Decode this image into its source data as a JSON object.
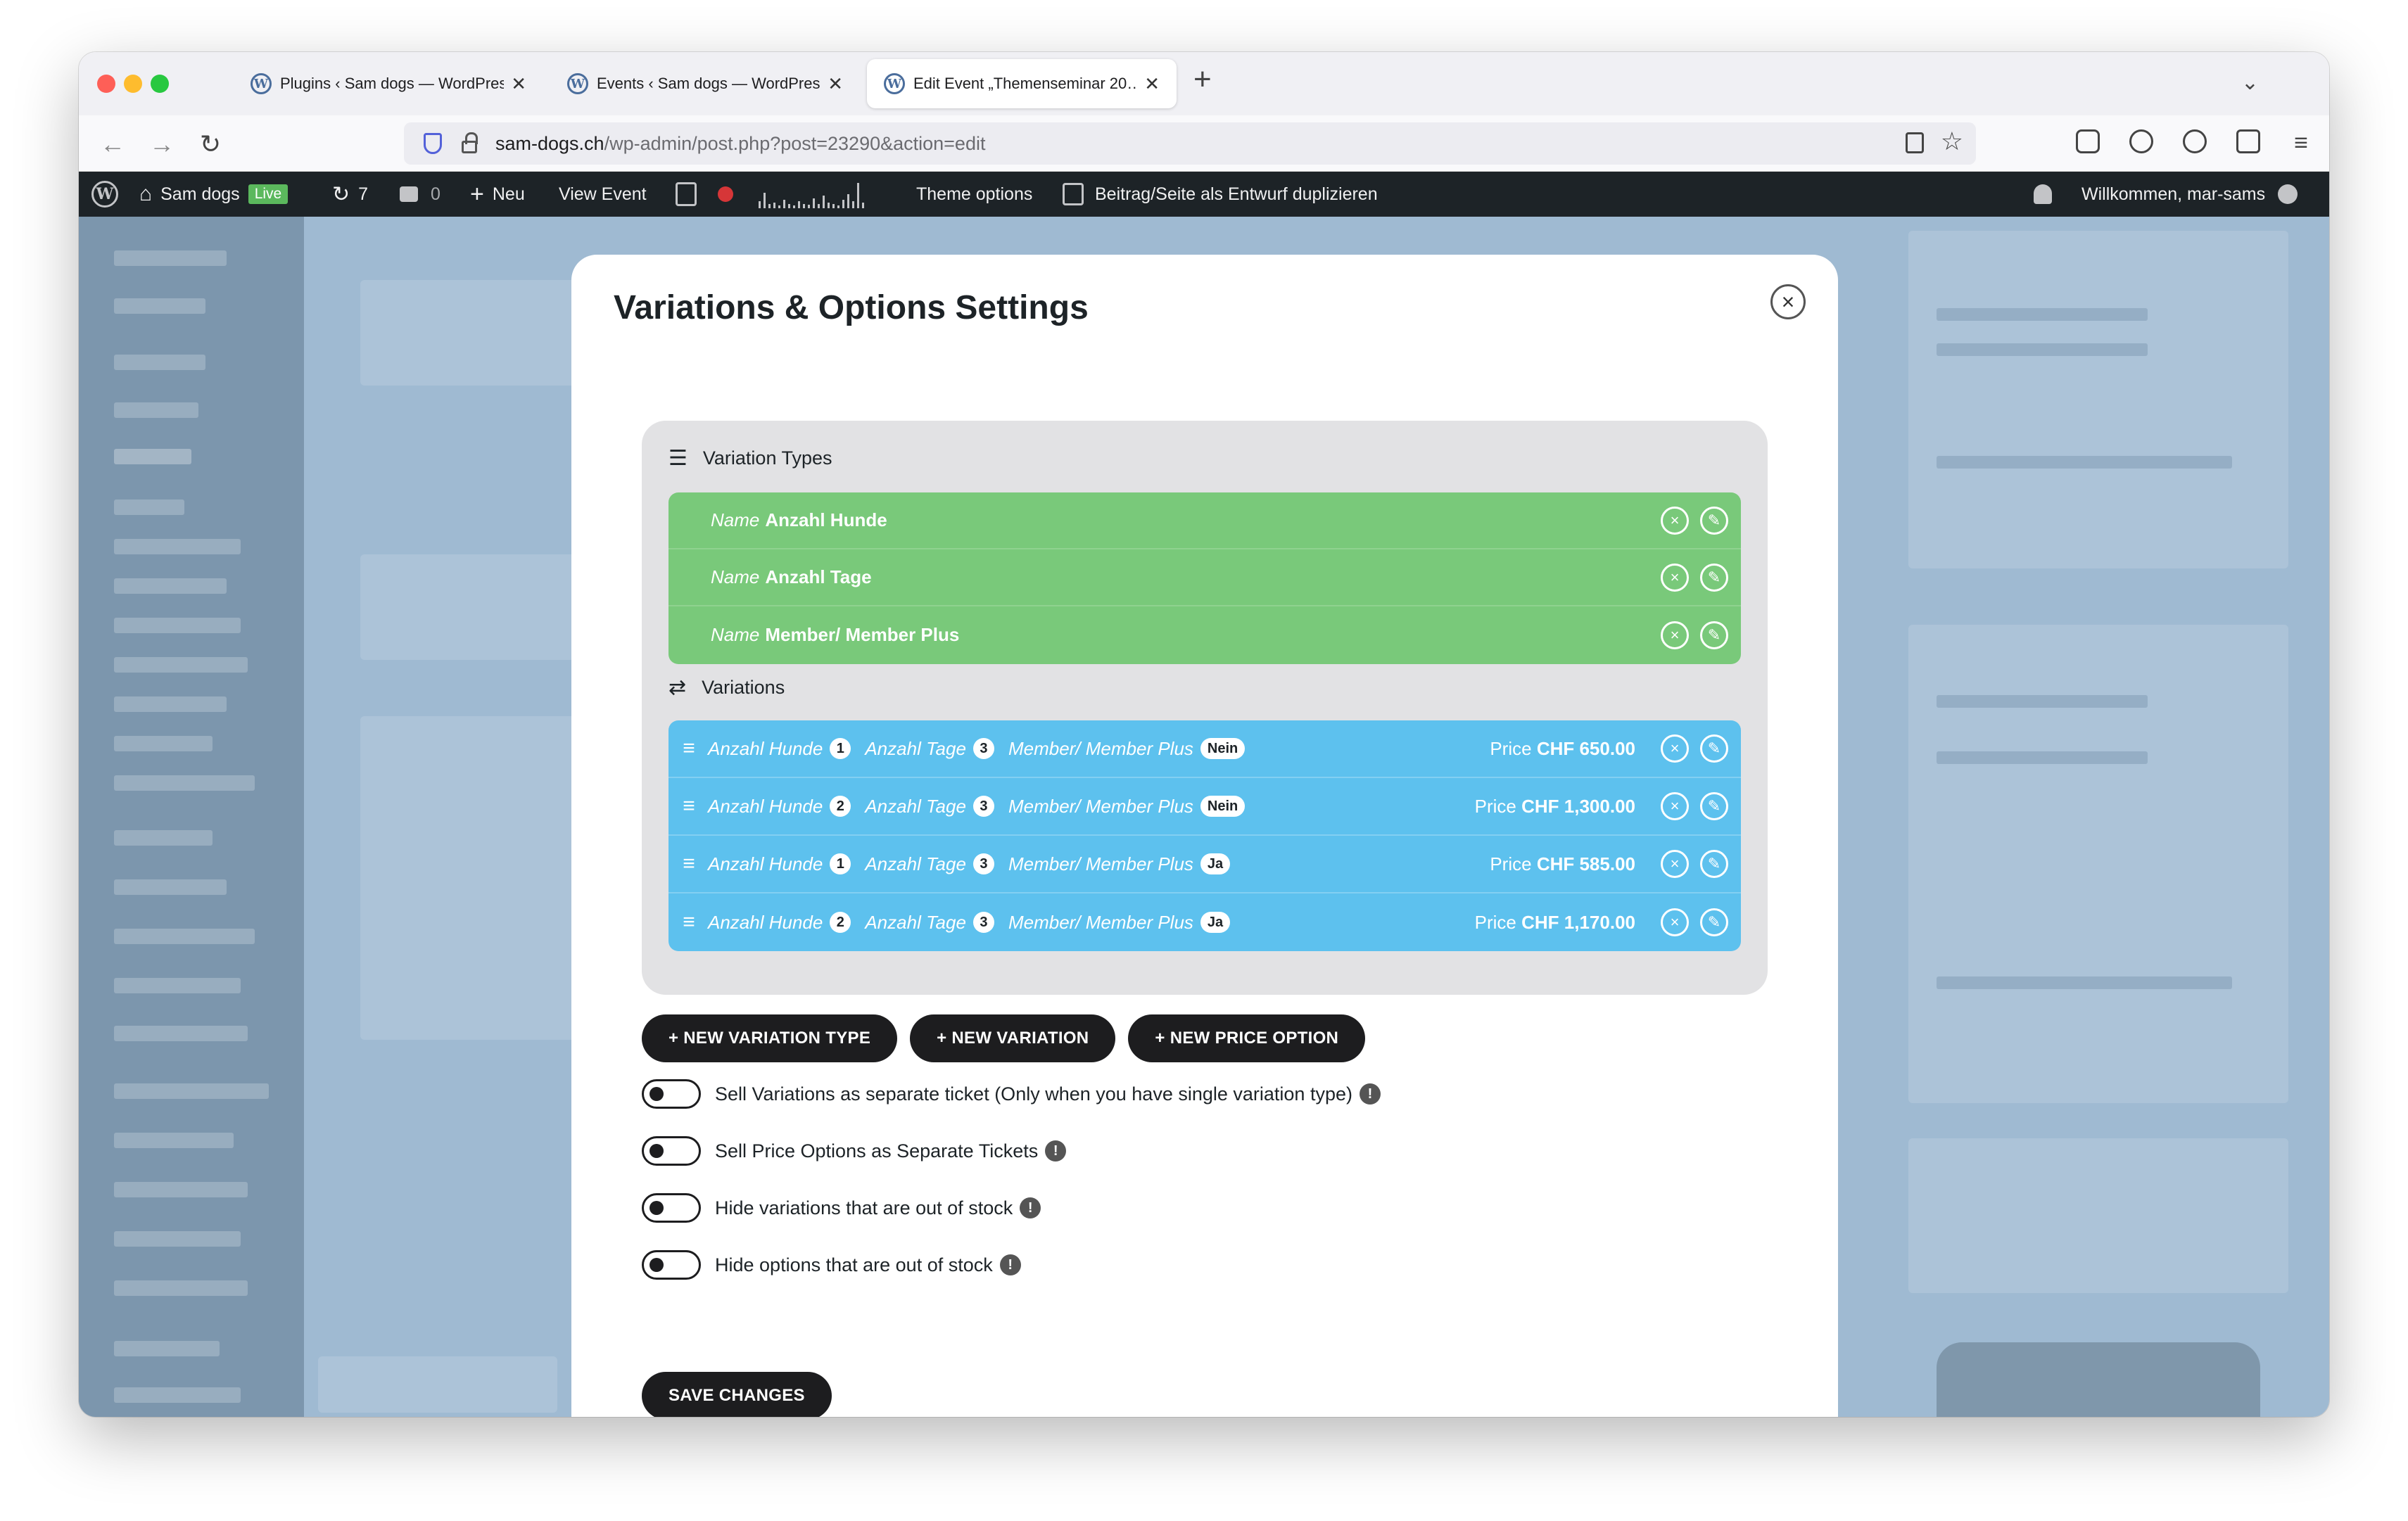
{
  "browser": {
    "tabs": [
      {
        "label": "Plugins ‹ Sam dogs — WordPress",
        "active": false
      },
      {
        "label": "Events ‹ Sam dogs — WordPress",
        "active": false
      },
      {
        "label": "Edit Event „Themenseminar 20…",
        "active": true
      }
    ],
    "new_tab": "+",
    "url_host": "sam-dogs.ch",
    "url_path": "/wp-admin/post.php?post=23290&action=edit"
  },
  "admin_bar": {
    "site_name": "Sam dogs",
    "live_badge": "Live",
    "updates_count": "7",
    "comments_count": "0",
    "new_label": "Neu",
    "view_event": "View Event",
    "theme_options": "Theme options",
    "duplicate": "Beitrag/Seite als Entwurf duplizieren",
    "greeting": "Willkommen, mar-sams"
  },
  "modal": {
    "title": "Variations & Options Settings",
    "variation_types_heading": "Variation Types",
    "variation_types": [
      {
        "field": "Name",
        "value": "Anzahl Hunde"
      },
      {
        "field": "Name",
        "value": "Anzahl Tage"
      },
      {
        "field": "Name",
        "value": "Member/ Member Plus"
      }
    ],
    "variations_heading": "Variations",
    "variations": [
      {
        "hunde_label": "Anzahl Hunde",
        "hunde": "1",
        "tage_label": "Anzahl Tage",
        "tage": "3",
        "member_label": "Member/ Member Plus",
        "member": "Nein",
        "price_label": "Price",
        "price": "CHF 650.00"
      },
      {
        "hunde_label": "Anzahl Hunde",
        "hunde": "2",
        "tage_label": "Anzahl Tage",
        "tage": "3",
        "member_label": "Member/ Member Plus",
        "member": "Nein",
        "price_label": "Price",
        "price": "CHF 1,300.00"
      },
      {
        "hunde_label": "Anzahl Hunde",
        "hunde": "1",
        "tage_label": "Anzahl Tage",
        "tage": "3",
        "member_label": "Member/ Member Plus",
        "member": "Ja",
        "price_label": "Price",
        "price": "CHF 585.00"
      },
      {
        "hunde_label": "Anzahl Hunde",
        "hunde": "2",
        "tage_label": "Anzahl Tage",
        "tage": "3",
        "member_label": "Member/ Member Plus",
        "member": "Ja",
        "price_label": "Price",
        "price": "CHF 1,170.00"
      }
    ],
    "buttons": {
      "new_variation_type": "+ NEW VARIATION TYPE",
      "new_variation": "+ NEW VARIATION",
      "new_price_option": "+ NEW PRICE OPTION",
      "save": "SAVE CHANGES"
    },
    "toggles": [
      {
        "label": "Sell Variations as separate ticket (Only when you have single variation type)",
        "on": false
      },
      {
        "label": "Sell Price Options as Separate Tickets",
        "on": false
      },
      {
        "label": "Hide variations that are out of stock",
        "on": false
      },
      {
        "label": "Hide options that are out of stock",
        "on": false
      }
    ],
    "info_glyph": "!"
  },
  "icons": {
    "close": "close-icon",
    "edit": "pencil-icon",
    "drag": "drag-handle-icon",
    "sliders": "sliders-icon",
    "shuffle": "shuffle-icon"
  },
  "colors": {
    "variation_type_bg": "#79c97a",
    "variation_bg": "#5dc1ee",
    "button_bg": "#1d1d1f",
    "admin_bar_bg": "#1d2327",
    "overlay_bg": "#9fbad2"
  }
}
